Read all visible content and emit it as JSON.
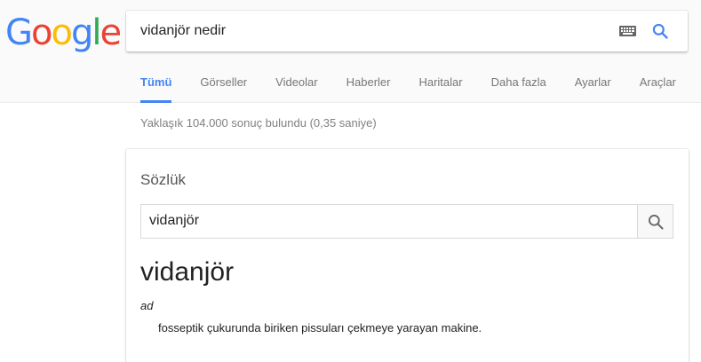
{
  "logo": {
    "letters": [
      "G",
      "o",
      "o",
      "g",
      "l",
      "e"
    ],
    "colors": [
      "#4285F4",
      "#EA4335",
      "#FBBC05",
      "#4285F4",
      "#34A853",
      "#EA4335"
    ]
  },
  "search": {
    "query": "vidanjör nedir",
    "keyboard_icon": "keyboard-icon",
    "search_icon": "search-icon",
    "accent_color": "#4285F4"
  },
  "tabs": [
    {
      "label": "Tümü",
      "active": true
    },
    {
      "label": "Görseller",
      "active": false
    },
    {
      "label": "Videolar",
      "active": false
    },
    {
      "label": "Haberler",
      "active": false
    },
    {
      "label": "Haritalar",
      "active": false
    },
    {
      "label": "Daha fazla",
      "active": false
    },
    {
      "label": "Ayarlar",
      "active": false
    },
    {
      "label": "Araçlar",
      "active": false
    }
  ],
  "stats": "Yaklaşık 104.000 sonuç bulundu (0,35 saniye)",
  "dictionary": {
    "title": "Sözlük",
    "search_value": "vidanjör",
    "search_icon": "search-icon",
    "word": "vidanjör",
    "part_of_speech": "ad",
    "definition": "fosseptik çukurunda biriken pissuları çekmeye yarayan makine."
  }
}
